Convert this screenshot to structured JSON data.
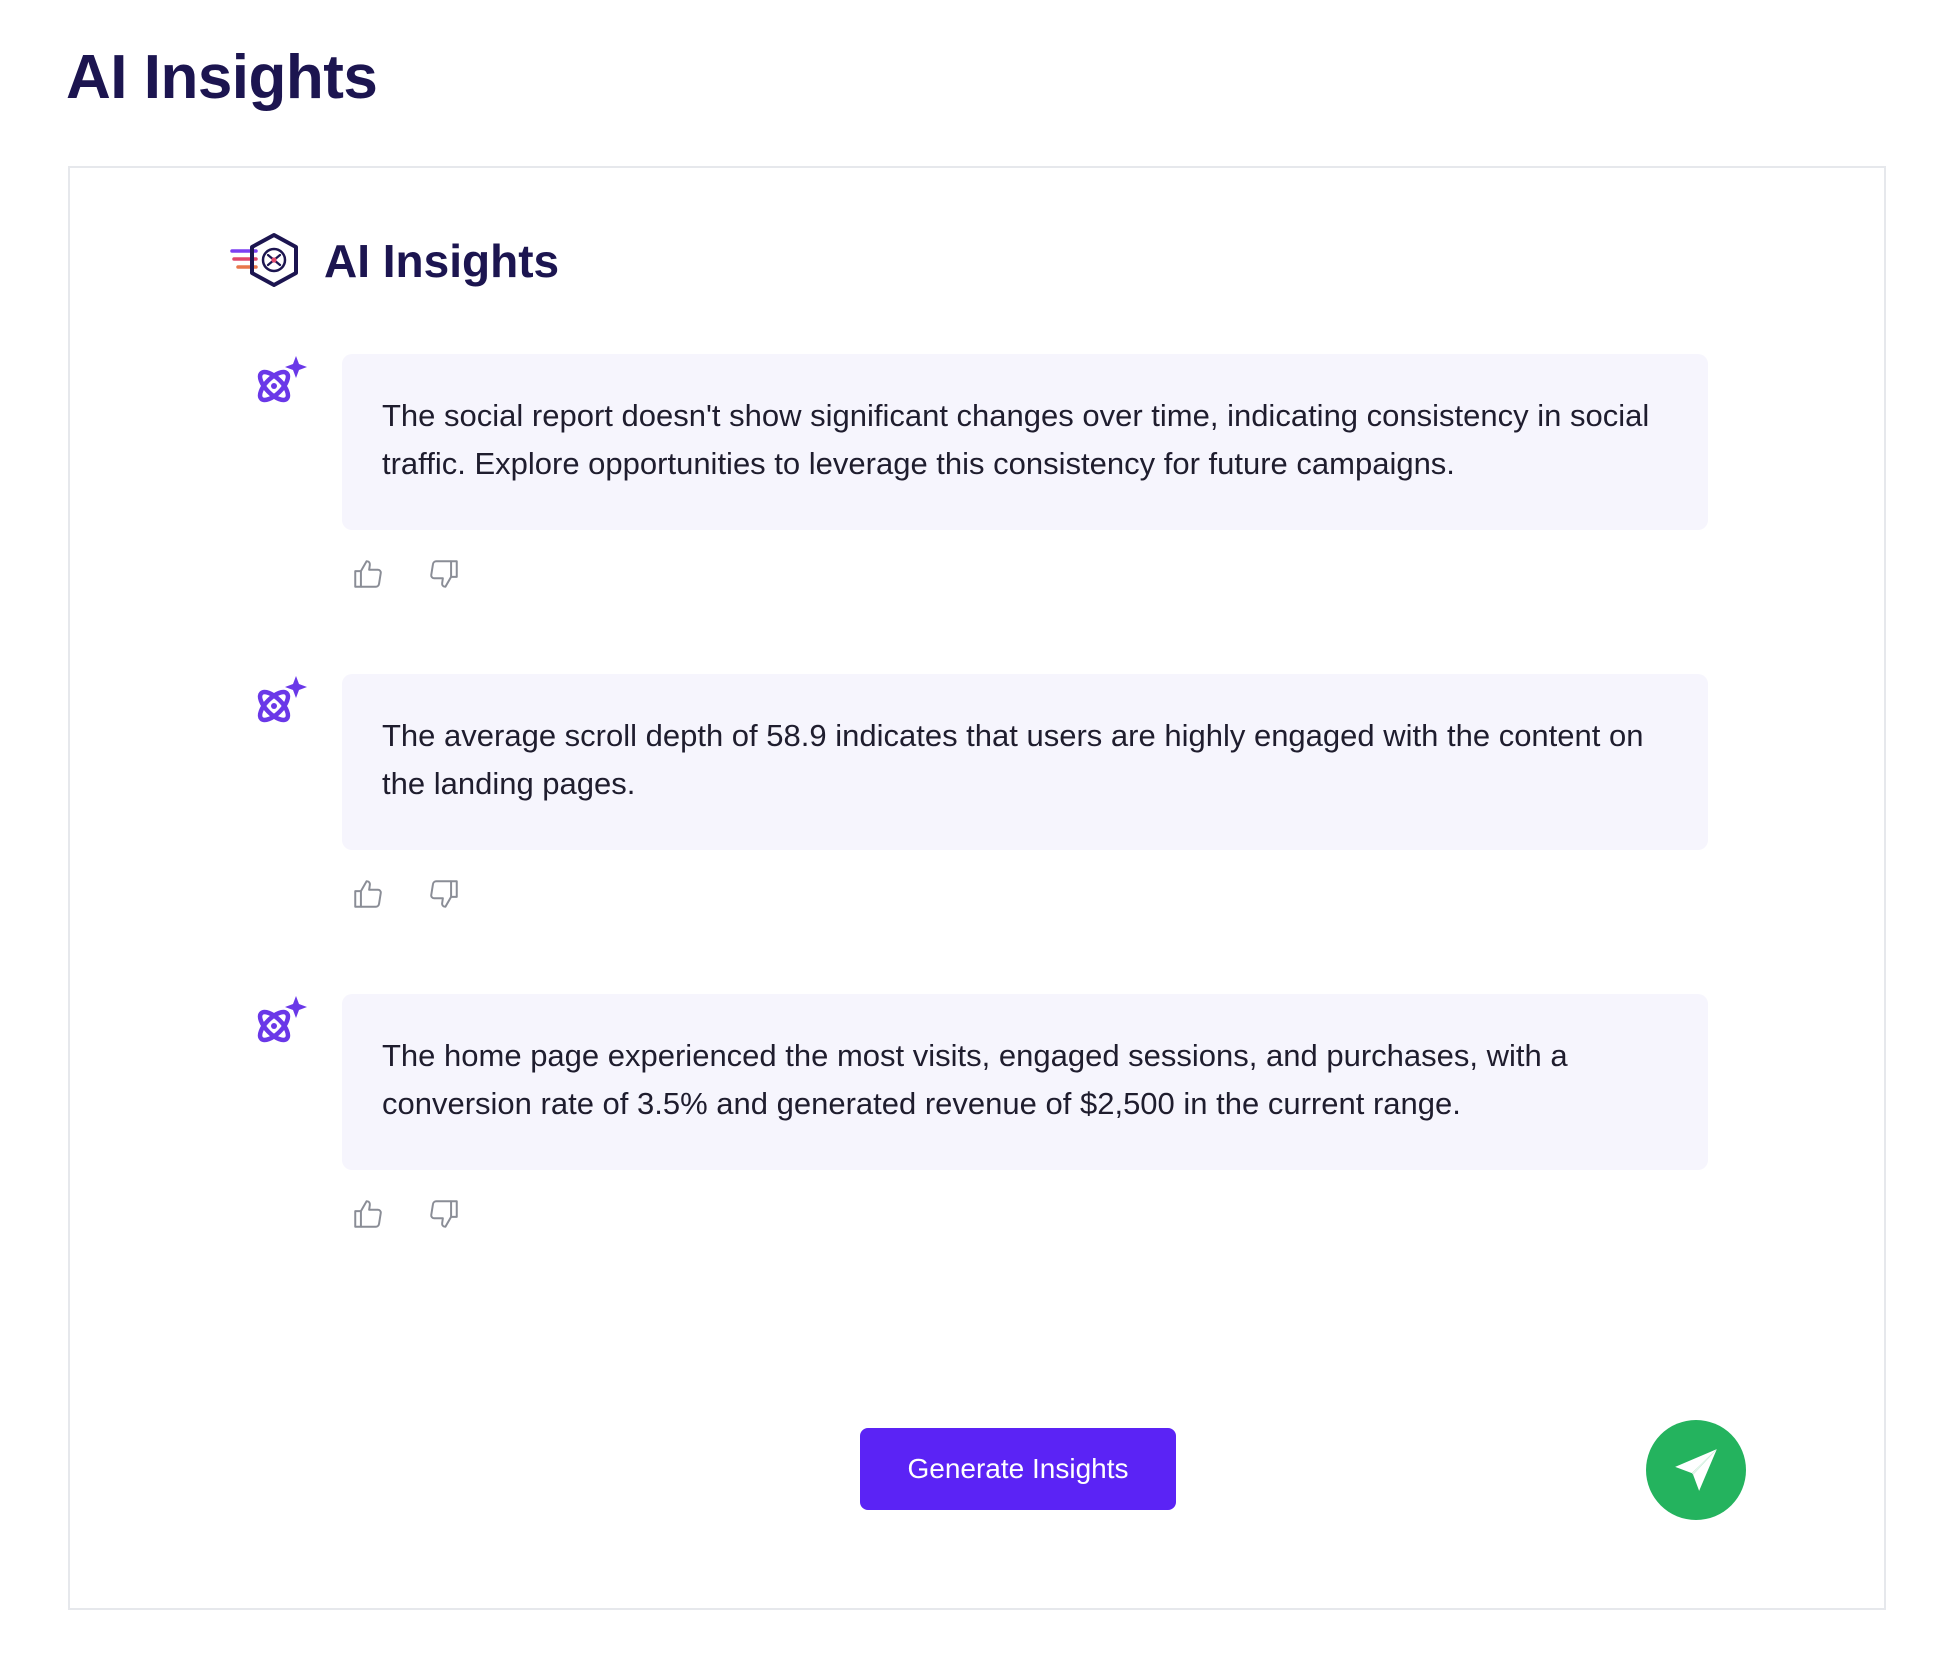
{
  "page": {
    "title": "AI Insights"
  },
  "panel": {
    "title": "AI Insights",
    "logo_icon": "hexagon-brain-logo-icon"
  },
  "insights": [
    {
      "text": "The social report doesn't show significant changes over time, indicating consistency in social traffic. Explore opportunities to leverage this consistency for future campaigns.",
      "icon": "ai-sparkle-icon"
    },
    {
      "text": "The average scroll depth of 58.9 indicates that users are highly engaged with the content on the landing pages.",
      "icon": "ai-sparkle-icon"
    },
    {
      "text": "The home page experienced the most visits, engaged sessions, and purchases, with a conversion rate of 3.5% and generated revenue of $2,500 in the current range.",
      "icon": "ai-sparkle-icon"
    }
  ],
  "actions": {
    "generate_label": "Generate Insights",
    "send_icon": "paper-plane-icon"
  },
  "colors": {
    "accent": "#5b23f5",
    "heading": "#1c1550",
    "bubble": "#f6f5fd",
    "send": "#24b35e"
  }
}
